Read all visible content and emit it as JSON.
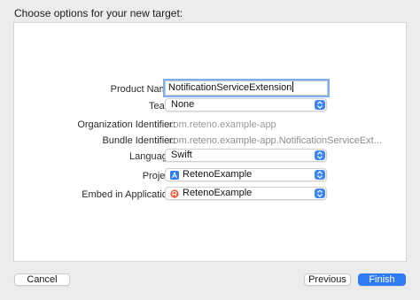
{
  "dialog": {
    "title": "Choose options for your new target:"
  },
  "form": {
    "product_name": {
      "label": "Product Name:",
      "value": "NotificationServiceExtension"
    },
    "team": {
      "label": "Team:",
      "value": "None"
    },
    "organization_identifier": {
      "label": "Organization Identifier:",
      "value": "com.reteno.example-app"
    },
    "bundle_identifier": {
      "label": "Bundle Identifier:",
      "value": "com.reteno.example-app.NotificationServiceExt..."
    },
    "language": {
      "label": "Language:",
      "value": "Swift"
    },
    "project": {
      "label": "Project:",
      "value": "RetenoExample",
      "icon": "xcode-project-icon"
    },
    "embed_in_application": {
      "label": "Embed in Application:",
      "value": "RetenoExample",
      "icon": "app-icon"
    }
  },
  "buttons": {
    "cancel": "Cancel",
    "previous": "Previous",
    "finish": "Finish"
  },
  "colors": {
    "accent": "#2f7bf3",
    "focus_ring": "#7eaef0",
    "placeholder_text": "#9a9a9a"
  }
}
